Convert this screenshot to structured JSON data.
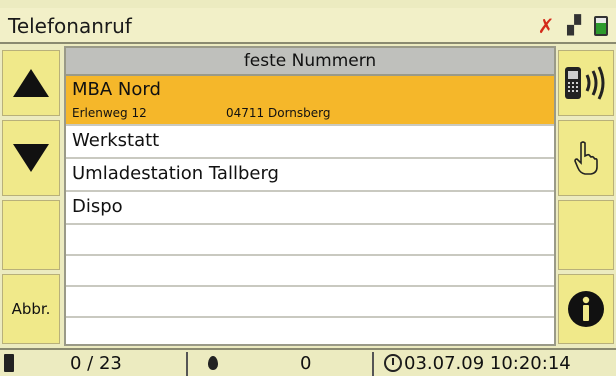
{
  "window": {
    "title": "Telefonanruf"
  },
  "status_icons": [
    "no-gps-icon",
    "signal-icon",
    "battery-icon"
  ],
  "list": {
    "header": "feste Nummern",
    "items": [
      {
        "name": "MBA Nord",
        "street": "Erlenweg 12",
        "city": "04711 Dornsberg",
        "selected": true
      },
      {
        "name": "Werkstatt"
      },
      {
        "name": "Umladestation Tallberg"
      },
      {
        "name": "Dispo"
      }
    ]
  },
  "left_buttons": {
    "up_icon": "arrow-up-icon",
    "down_icon": "arrow-down-icon",
    "abort_label": "Abbr."
  },
  "right_buttons": {
    "call_icon": "phone-call-icon",
    "touch_icon": "hand-pointer-icon",
    "info_icon": "info-icon"
  },
  "bottom_bar": {
    "count": "0 / 23",
    "drops": "0",
    "datetime": "03.07.09 10:20:14"
  },
  "colors": {
    "selected_row": "#f5b72a",
    "button_bg": "#f0e98a",
    "header_bg": "#bfc0bc",
    "no_gps": "#d42a1a"
  }
}
